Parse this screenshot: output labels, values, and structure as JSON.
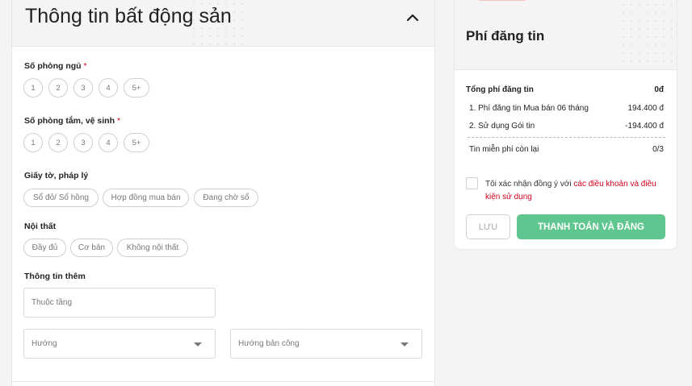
{
  "property": {
    "title": "Thông tin bất động sản",
    "bedrooms": {
      "label": "Số phòng ngủ",
      "required_mark": "*",
      "options": [
        "1",
        "2",
        "3",
        "4",
        "5+"
      ]
    },
    "bathrooms": {
      "label": "Số phòng tắm, vệ sinh",
      "required_mark": "*",
      "options": [
        "1",
        "2",
        "3",
        "4",
        "5+"
      ]
    },
    "legal": {
      "label": "Giấy tờ, pháp lý",
      "options": [
        "Sổ đỏ/ Sổ hồng",
        "Hợp đồng mua bán",
        "Đang chờ sổ"
      ]
    },
    "furniture": {
      "label": "Nội thất",
      "options": [
        "Đầy đủ",
        "Cơ bản",
        "Không nội thất"
      ]
    },
    "extra": {
      "label": "Thông tin thêm",
      "floor_placeholder": "Thuộc tầng",
      "direction_placeholder": "Hướng",
      "balcony_placeholder": "Hướng bản công"
    }
  },
  "fee": {
    "title": "Phí đăng tin",
    "total_label": "Tổng phí đăng tin",
    "total_value": "0đ",
    "items": [
      {
        "label": "1. Phí đăng tin Mua bán 06 tháng",
        "value": "194.400 đ"
      },
      {
        "label": "2. Sử dụng Gói tin",
        "value": "-194.400 đ"
      }
    ],
    "free_label": "Tin miễn phí còn lại",
    "free_value": "0/3",
    "agree_text": "Tôi xác nhận đồng ý với ",
    "agree_link": "các điều khoản và điều kiện sử dụng",
    "save_label": "LƯU",
    "pay_label": "THANH TOÁN VÀ ĐĂNG",
    "accent_color": "#5fc68f",
    "link_color": "#d0021b"
  }
}
